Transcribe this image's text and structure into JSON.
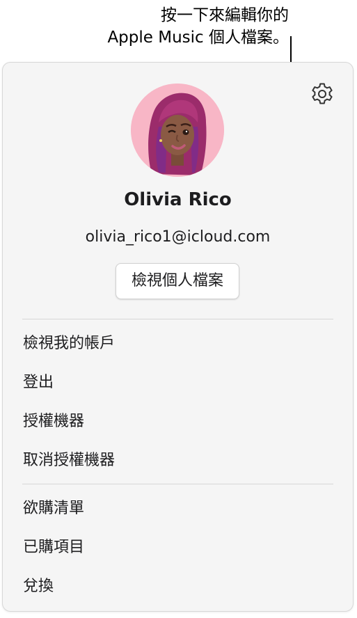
{
  "callout": {
    "line1": "按一下來編輯你的",
    "line2": "Apple Music 個人檔案。"
  },
  "profile": {
    "name": "Olivia Rico",
    "email": "olivia_rico1@icloud.com",
    "view_profile_label": "檢視個人檔案"
  },
  "menu": {
    "group1": [
      "檢視我的帳戶",
      "登出",
      "授權機器",
      "取消授權機器"
    ],
    "group2": [
      "欲購清單",
      "已購項目",
      "兌換"
    ]
  },
  "icons": {
    "settings": "gear-icon",
    "avatar": "memoji-avatar"
  },
  "colors": {
    "panel_bg": "#f5f5f5",
    "avatar_bg": "#f8b6c6",
    "hair": "#9b2c6b",
    "skin": "#8a5a44"
  }
}
